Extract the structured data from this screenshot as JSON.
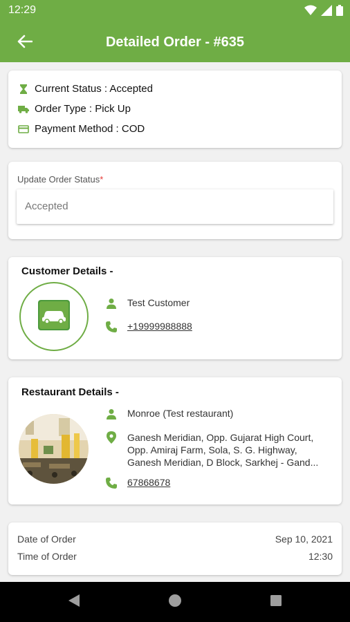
{
  "status_bar": {
    "time": "12:29"
  },
  "app_bar": {
    "title": "Detailed Order - #635"
  },
  "order_summary": {
    "current_status": "Current Status : Accepted",
    "order_type": "Order Type : Pick Up",
    "payment_method": "Payment Method : COD"
  },
  "update_status": {
    "label": "Update Order Status",
    "required_mark": "*",
    "value": "Accepted"
  },
  "customer": {
    "section_title": "Customer Details -",
    "name": "Test Customer",
    "phone": "+19999988888"
  },
  "restaurant": {
    "section_title": "Restaurant Details -",
    "name": "Monroe (Test restaurant)",
    "address_lines": [
      "Ganesh Meridian, Opp. Gujarat High Court,",
      "Opp. Amiraj Farm, Sola, S. G. Highway,",
      "Ganesh Meridian, D Block, Sarkhej - Gand..."
    ],
    "phone": "67868678"
  },
  "order_time": {
    "date_label": "Date of Order",
    "date_value": "Sep 10, 2021",
    "time_label": "Time of Order",
    "time_value": "12:30"
  },
  "colors": {
    "accent": "#6fad45",
    "required": "#e53935"
  },
  "icons": {
    "status": "hourglass-icon",
    "order_type": "truck-icon",
    "payment": "card-icon",
    "person": "person-icon",
    "phone": "phone-icon",
    "location": "location-pin-icon"
  }
}
